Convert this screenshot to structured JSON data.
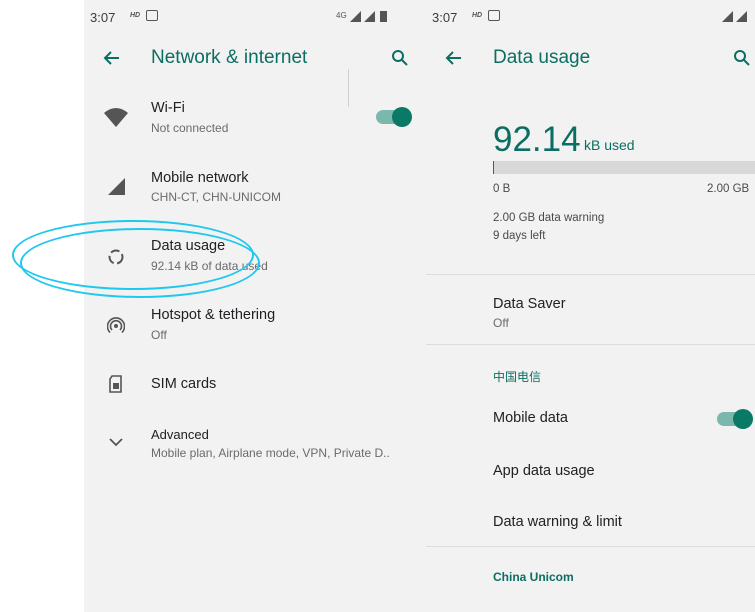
{
  "left": {
    "status": {
      "time": "3:07",
      "hd": "HD",
      "net": "4G"
    },
    "title": "Network & internet",
    "items": [
      {
        "title": "Wi-Fi",
        "subtitle": "Not connected"
      },
      {
        "title": "Mobile network",
        "subtitle": "CHN-CT, CHN-UNICOM"
      },
      {
        "title": "Data usage",
        "subtitle": "92.14 kB of data used"
      },
      {
        "title": "Hotspot & tethering",
        "subtitle": "Off"
      },
      {
        "title": "SIM cards",
        "subtitle": ""
      },
      {
        "title": "Advanced",
        "subtitle": "Mobile plan, Airplane mode, VPN, Private D.."
      }
    ],
    "wifi_toggle_on": true
  },
  "right": {
    "status": {
      "time": "3:07",
      "hd": "HD"
    },
    "title": "Data usage",
    "usage_value": "92.14",
    "usage_unit": "kB used",
    "bar_fraction": 4e-05,
    "bar_min": "0 B",
    "bar_max": "2.00 GB",
    "warning": "2.00 GB data warning",
    "days_left": "9 days left",
    "data_saver": {
      "title": "Data Saver",
      "subtitle": "Off"
    },
    "carrier1": "中国电信",
    "mobile_data": "Mobile data",
    "mobile_data_on": true,
    "app_data_usage": "App data usage",
    "warning_limit": "Data warning & limit",
    "carrier2": "China Unicom"
  },
  "colors": {
    "accent": "#0a7a67",
    "title": "#0c6e62",
    "highlight": "#1ec8ee"
  }
}
